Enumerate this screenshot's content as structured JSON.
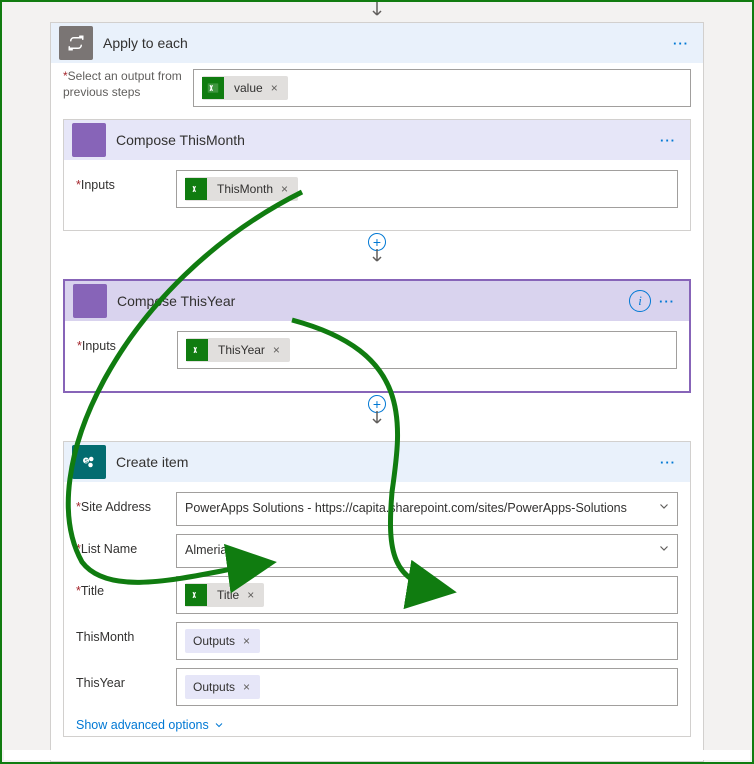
{
  "applyToEach": {
    "title": "Apply to each",
    "selectOutputLabel": "Select an output from previous steps",
    "valueToken": "value"
  },
  "composeMonth": {
    "title": "Compose ThisMonth",
    "inputsLabel": "Inputs",
    "token": "ThisMonth"
  },
  "composeYear": {
    "title": "Compose ThisYear",
    "inputsLabel": "Inputs",
    "token": "ThisYear"
  },
  "createItem": {
    "title": "Create item",
    "fields": {
      "siteAddressLabel": "Site Address",
      "siteAddressValue": "PowerApps Solutions - https://capita.sharepoint.com/sites/PowerApps-Solutions",
      "listNameLabel": "List Name",
      "listNameValue": "Almeria",
      "titleLabel": "Title",
      "titleToken": "Title",
      "thisMonthLabel": "ThisMonth",
      "thisMonthToken": "Outputs",
      "thisYearLabel": "ThisYear",
      "thisYearToken": "Outputs",
      "advanced": "Show advanced options"
    }
  },
  "glyphs": {
    "remove": "×",
    "dots": "···",
    "info": "i",
    "x": "×",
    "chevDown": "⌄",
    "plus": "+"
  }
}
